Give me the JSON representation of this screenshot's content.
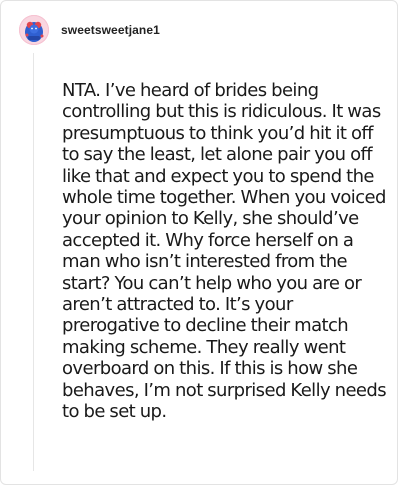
{
  "comment": {
    "username": "sweetsweetjane1",
    "avatar_icon": "user-avatar-illustration",
    "body": "NTA. I’ve heard of brides being controlling but this is ridiculous. It was presumptuous to think you’d hit it off to say the least, let alone pair you off like that and expect you to spend the whole time together. When you voiced your opinion to Kelly, she should’ve accepted it. Why force herself on a man who isn’t interested from the start? You can’t help who you are or aren’t attracted to. It’s your prerogative to decline their match making scheme. They really went overboard on this. If this is how she behaves, I’m not surprised Kelly needs to be set up."
  },
  "colors": {
    "text": "#1a1a1a",
    "border": "#e3e3e3",
    "avatar_bg": "#f3b7c8",
    "avatar_figure": "#2f5fd0"
  }
}
